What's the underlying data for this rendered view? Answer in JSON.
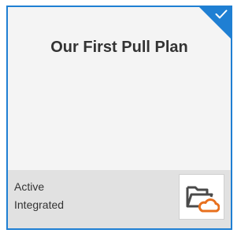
{
  "tile": {
    "title": "Our First Pull Plan",
    "selected": true,
    "status_line_1": "Active",
    "status_line_2": "Integrated",
    "icon": "folder-cloud-icon",
    "selected_icon": "checkmark-icon"
  },
  "colors": {
    "accent": "#1f7fd3",
    "cloud": "#e8701e",
    "folder": "#4a4a4a",
    "tile_bg": "#f4f4f4",
    "footer_bg": "#e1e1e1"
  }
}
